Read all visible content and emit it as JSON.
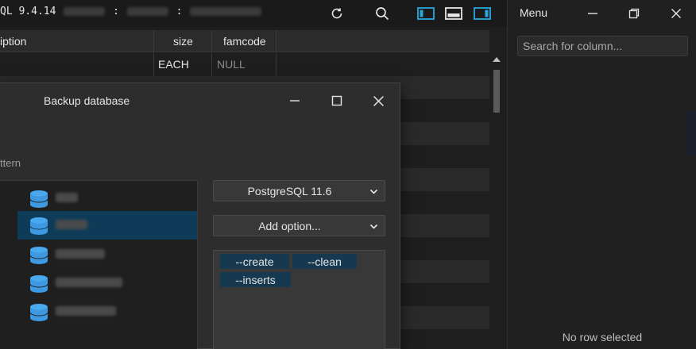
{
  "topbar": {
    "title_prefix": "QL 9.4.14",
    "sep1": ":",
    "sep2": ":",
    "icons": [
      "refresh-icon",
      "search-icon",
      "layout-left-panel-icon",
      "layout-bottom-panel-icon",
      "layout-right-panel-icon"
    ]
  },
  "grid": {
    "columns": [
      "iption",
      "size",
      "famcode"
    ],
    "rows": [
      {
        "description": "",
        "size": "EACH",
        "famcode": "NULL"
      }
    ]
  },
  "right_panel": {
    "menu_label": "Menu",
    "search_placeholder": "Search for column...",
    "status": "No row selected"
  },
  "dialog": {
    "title": "Backup database",
    "pattern_label": "ttern",
    "databases": [
      {
        "name": "db1",
        "selected": false
      },
      {
        "name": "db2",
        "selected": true
      },
      {
        "name": "db3",
        "selected": false
      },
      {
        "name": "db4",
        "selected": false
      },
      {
        "name": "db5",
        "selected": false
      }
    ],
    "version_select": "PostgreSQL 11.6",
    "add_option_select": "Add option...",
    "options": [
      "--create",
      "--clean",
      "--inserts"
    ]
  },
  "colors": {
    "accent": "#29a8e0",
    "selected_row": "#0e3c58",
    "chip": "#16394f",
    "db_icon": "#4aa8ee"
  }
}
